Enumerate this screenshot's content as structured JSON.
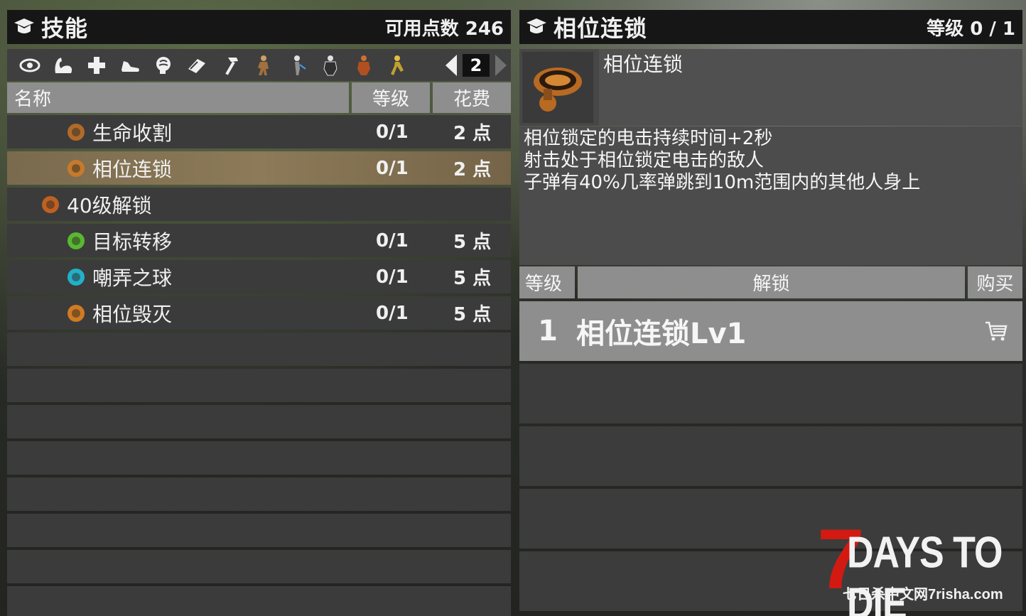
{
  "left_panel": {
    "title": "技能",
    "points_label": "可用点数 246",
    "toolbar_icons": [
      "eye-icon",
      "muscle-icon",
      "plus-icon",
      "sneaker-icon",
      "brain-icon",
      "book-icon",
      "hammer-icon",
      "character-icon",
      "character-icon",
      "character-icon",
      "character-icon",
      "character-icon"
    ],
    "page": "2",
    "columns": {
      "name": "名称",
      "level": "等级",
      "cost": "花费"
    },
    "rows": [
      {
        "name": "生命收割",
        "level": "0/1",
        "cost": "2 点",
        "icon": "scythe-icon",
        "icon_color": "#b06a2a",
        "selected": false,
        "indent": 1
      },
      {
        "name": "相位连锁",
        "level": "0/1",
        "cost": "2 点",
        "icon": "disc-icon",
        "icon_color": "#c77a2c",
        "selected": true,
        "indent": 1
      },
      {
        "name": "40级解锁",
        "level": "",
        "cost": "",
        "icon": "demon-icon",
        "icon_color": "#c06020",
        "selected": false,
        "indent": 0
      },
      {
        "name": "目标转移",
        "level": "0/1",
        "cost": "5 点",
        "icon": "target-shift-icon",
        "icon_color": "#5ab830",
        "selected": false,
        "indent": 1
      },
      {
        "name": "嘲弄之球",
        "level": "0/1",
        "cost": "5 点",
        "icon": "vortex-icon",
        "icon_color": "#22b0c8",
        "selected": false,
        "indent": 1
      },
      {
        "name": "相位毁灭",
        "level": "0/1",
        "cost": "5 点",
        "icon": "demon-icon",
        "icon_color": "#d07a22",
        "selected": false,
        "indent": 1
      }
    ],
    "empty_row_count": 8
  },
  "right_panel": {
    "title": "相位连锁",
    "level_label": "等级 0 / 1",
    "item_name": "相位连锁",
    "description": [
      "相位锁定的电击持续时间+2秒",
      "射击处于相位锁定电击的敌人",
      "子弹有40%几率弹跳到10m范围内的其他人身上"
    ],
    "unlock_columns": {
      "level": "等级",
      "unlock": "解锁",
      "buy": "购买"
    },
    "unlocks": [
      {
        "level": "1",
        "name": "相位连锁Lv1"
      }
    ],
    "empty_unlock_rows": 4
  },
  "watermark": {
    "logo_number": "7",
    "logo_text": "DAYS TO DIE",
    "site_text": "七日杀中文网7risha.com"
  }
}
